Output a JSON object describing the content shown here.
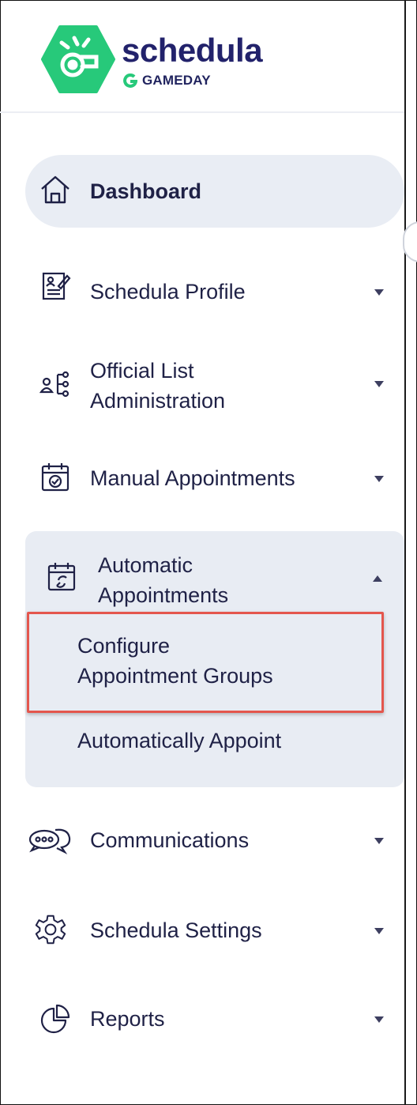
{
  "brand": {
    "name": "schedula",
    "sub": "GAMEDAY",
    "colors": {
      "logo_green": "#27c97a",
      "brand_navy": "#22226b"
    }
  },
  "nav": {
    "dashboard": {
      "label": "Dashboard",
      "icon": "home-icon",
      "active": true
    },
    "profile": {
      "label": "Schedula Profile",
      "icon": "profile-form-icon"
    },
    "official_list": {
      "label_line1": "Official List",
      "label_line2": "Administration",
      "icon": "org-tree-icon"
    },
    "manual": {
      "label": "Manual Appointments",
      "icon": "calendar-check-icon"
    },
    "automatic": {
      "label_line1": "Automatic",
      "label_line2": "Appointments",
      "icon": "calendar-auto-icon",
      "expanded": true,
      "children": {
        "configure_line1": "Configure",
        "configure_line2": "Appointment Groups",
        "appoint": "Automatically Appoint"
      }
    },
    "communications": {
      "label": "Communications",
      "icon": "chat-bubbles-icon"
    },
    "settings": {
      "label": "Schedula Settings",
      "icon": "gear-icon"
    },
    "reports": {
      "label": "Reports",
      "icon": "pie-chart-icon"
    }
  },
  "highlight_color": "#e4564d"
}
